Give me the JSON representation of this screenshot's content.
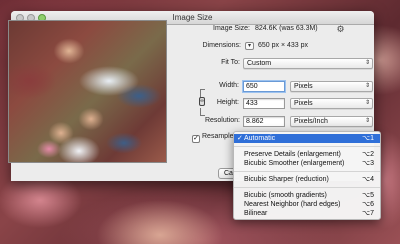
{
  "window": {
    "title": "Image Size"
  },
  "info": {
    "image_size_label": "Image Size:",
    "image_size_value": "824.6K (was 63.3M)",
    "dimensions_label": "Dimensions:",
    "dimensions_value": "650 px  ×  433 px"
  },
  "fit_to": {
    "label": "Fit To:",
    "value": "Custom"
  },
  "width": {
    "label": "Width:",
    "value": "650",
    "unit": "Pixels"
  },
  "height": {
    "label": "Height:",
    "value": "433",
    "unit": "Pixels"
  },
  "resolution": {
    "label": "Resolution:",
    "value": "8.862",
    "unit": "Pixels/Inch"
  },
  "resample": {
    "label": "Resample",
    "checked": true
  },
  "buttons": {
    "cancel": "Ca"
  },
  "resample_menu": {
    "items": [
      {
        "label": "Automatic",
        "shortcut": "⌥1",
        "selected": true
      },
      {
        "label": "Preserve Details (enlargement)",
        "shortcut": "⌥2"
      },
      {
        "label": "Bicubic Smoother (enlargement)",
        "shortcut": "⌥3"
      },
      {
        "label": "Bicubic Sharper (reduction)",
        "shortcut": "⌥4"
      },
      {
        "label": "Bicubic (smooth gradients)",
        "shortcut": "⌥5"
      },
      {
        "label": "Nearest Neighbor (hard edges)",
        "shortcut": "⌥6"
      },
      {
        "label": "Bilinear",
        "shortcut": "⌥7"
      }
    ]
  },
  "icons": {
    "gear": "gear-icon",
    "dimension_toggle": "chevron-down-icon",
    "constrain_link": "chain-link-icon",
    "select_arrows": "updown-arrows-icon",
    "checkmark": "checkmark-icon"
  },
  "colors": {
    "menu_highlight": "#2f6fd8",
    "focus_ring": "#6a9ad6"
  }
}
